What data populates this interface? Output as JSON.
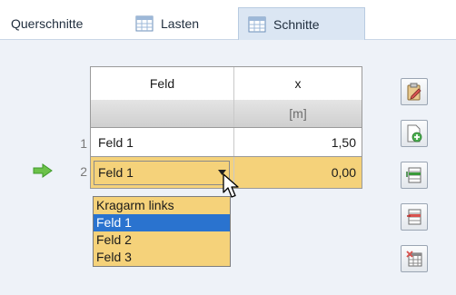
{
  "tabs": [
    {
      "label": "Querschnitte",
      "active": false,
      "icon": "none"
    },
    {
      "label": "Lasten",
      "active": false,
      "icon": "table-icon"
    },
    {
      "label": "Schnitte",
      "active": true,
      "icon": "table-icon"
    }
  ],
  "grid": {
    "columns": [
      {
        "header": "Feld",
        "unit": ""
      },
      {
        "header": "x",
        "unit": "[m]"
      }
    ],
    "rows": [
      {
        "num": "1",
        "feld": "Feld 1",
        "x": "1,50",
        "current": false
      },
      {
        "num": "2",
        "feld": "Feld 1",
        "x": "0,00",
        "current": true
      }
    ]
  },
  "dropdown": {
    "options": [
      "Kragarm links",
      "Feld 1",
      "Feld 2",
      "Feld 3"
    ],
    "selected": "Feld 1"
  },
  "toolbar": [
    {
      "icon": "edit-clipboard-icon"
    },
    {
      "icon": "new-document-icon"
    },
    {
      "icon": "insert-row-icon"
    },
    {
      "icon": "delete-row-icon"
    },
    {
      "icon": "delete-table-icon"
    }
  ],
  "colors": {
    "active_row": "#f5d27a",
    "selection": "#2a73cf",
    "arrow": "#6cc24a",
    "tab_active": "#dbe6f3"
  }
}
